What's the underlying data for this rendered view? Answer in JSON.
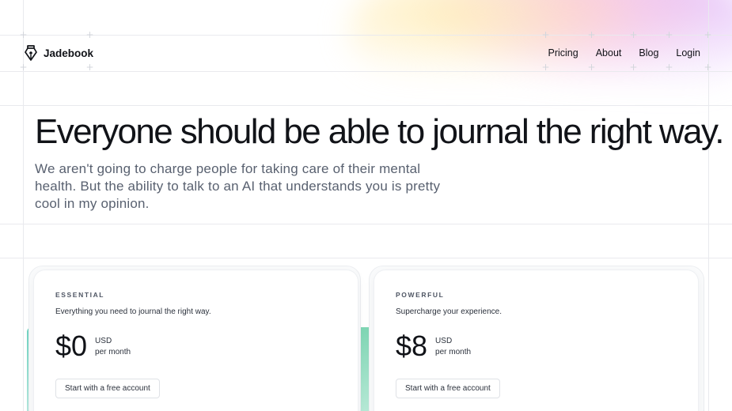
{
  "brand": {
    "name": "Jadebook",
    "icon": "pen-nib-icon"
  },
  "nav": {
    "items": [
      "Pricing",
      "About",
      "Blog",
      "Login"
    ]
  },
  "hero": {
    "title": "Everyone should be able to journal the right way.",
    "subtitle": "We aren't going to charge people for taking care of their mental health. But the ability to talk to an AI that understands you is pretty cool in my opinion."
  },
  "plans": [
    {
      "tier": "ESSENTIAL",
      "description": "Everything you need to journal the right way.",
      "price": "$0",
      "currency": "USD",
      "period": "per month",
      "cta": "Start with a free account"
    },
    {
      "tier": "POWERFUL",
      "description": "Supercharge your experience.",
      "price": "$8",
      "currency": "USD",
      "period": "per month",
      "cta": "Start with a free account"
    }
  ],
  "colors": {
    "accent": "#6fd3c1",
    "text": "#111318",
    "muted": "#596170"
  }
}
